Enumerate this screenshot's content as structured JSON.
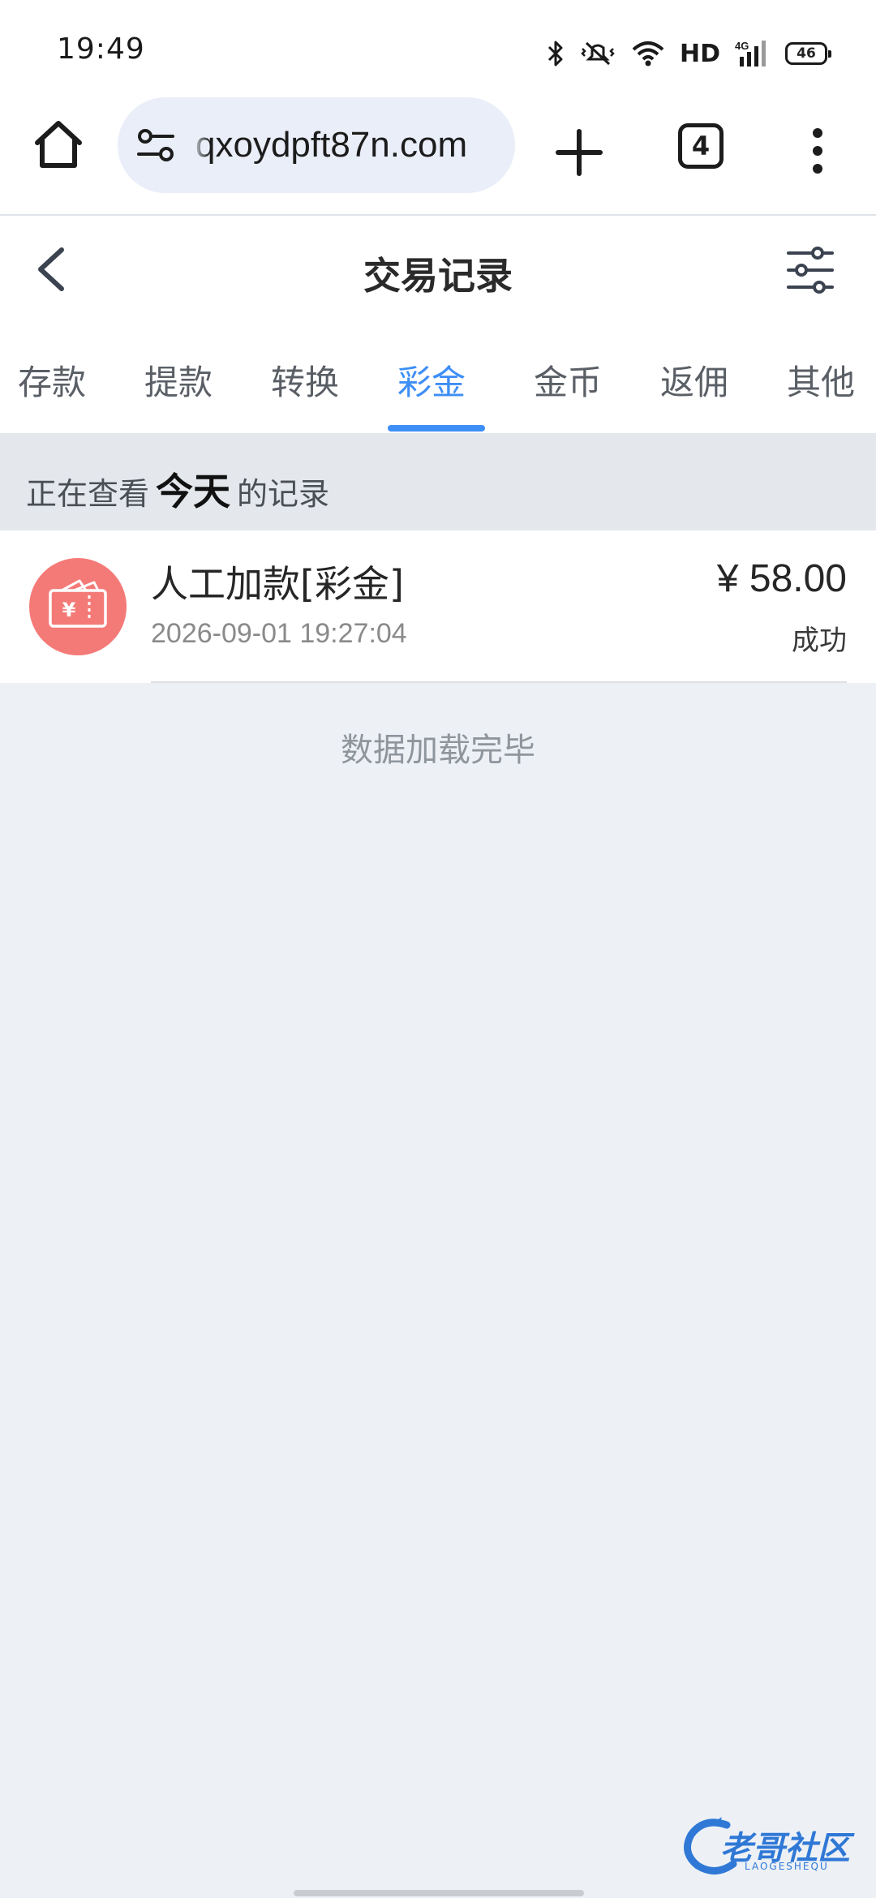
{
  "status_bar": {
    "time": "19:49",
    "network": "HD",
    "battery": "46",
    "icons": [
      "bluetooth-icon",
      "mute-vibrate-icon",
      "wifi-icon",
      "4g-signal-icon",
      "battery-icon"
    ]
  },
  "browser": {
    "url": "qxoydpft87n.com",
    "tab_count": "4"
  },
  "header": {
    "title": "交易记录"
  },
  "tabs": [
    {
      "label": "存款"
    },
    {
      "label": "提款"
    },
    {
      "label": "转换"
    },
    {
      "label": "彩金",
      "active": true
    },
    {
      "label": "金币"
    },
    {
      "label": "返佣"
    },
    {
      "label": "其他"
    }
  ],
  "viewing": {
    "prefix": "正在查看",
    "period": "今天",
    "suffix": "的记录"
  },
  "records": [
    {
      "title": "人工加款[彩金]",
      "time": "2026-09-01 19:27:04",
      "amount": "¥ 58.00",
      "status": "成功"
    }
  ],
  "list_footer": "数据加载完毕",
  "watermark": {
    "text": "老哥社区",
    "sub": "LAOGESHEQU"
  },
  "colors": {
    "accent": "#3e8ef7",
    "record_icon_bg": "#f47a78",
    "page_bg": "#edf1f6"
  }
}
